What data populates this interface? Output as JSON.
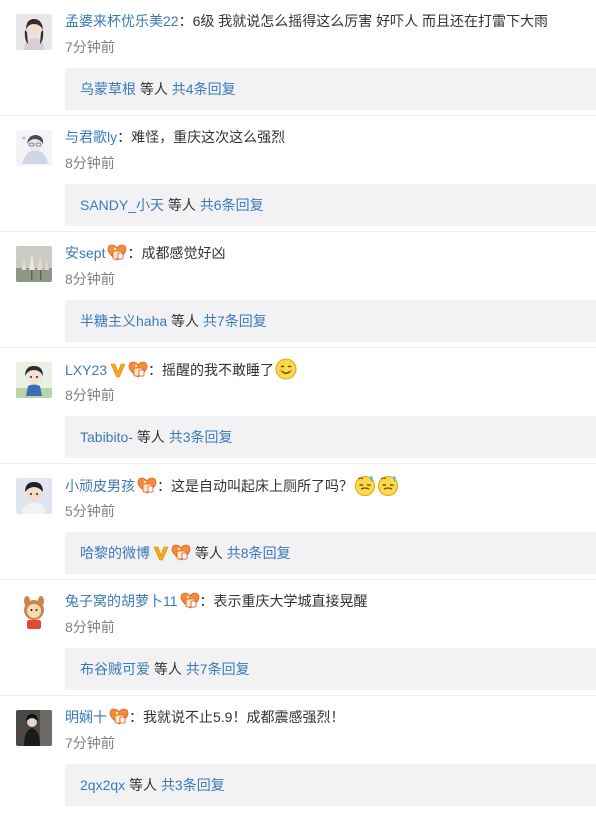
{
  "comments": [
    {
      "username": "孟婆来杯优乐美22",
      "sep": "：",
      "text": "6级 我就说怎么摇得这么厉害 好吓人 而且还在打雷下大雨",
      "time": "7分钟前",
      "reply_user": "乌蒙草根",
      "reply_mid": " 等人 ",
      "reply_count": "共4条回复"
    },
    {
      "username": "与君歌ly",
      "sep": "：",
      "text": "难怪，重庆这次这么强烈",
      "time": "8分钟前",
      "reply_user": "SANDY_小天",
      "reply_mid": " 等人 ",
      "reply_count": "共6条回复"
    },
    {
      "username": "安sept",
      "sep": "：",
      "text": "成都感觉好凶",
      "time": "8分钟前",
      "reply_user": "半糖主义haha",
      "reply_mid": " 等人 ",
      "reply_count": "共7条回复"
    },
    {
      "username": "LXY23",
      "sep": "：",
      "text": "摇醒的我不敢睡了",
      "time": "8分钟前",
      "reply_user": "Tabibito-",
      "reply_mid": " 等人 ",
      "reply_count": "共3条回复"
    },
    {
      "username": "小顽皮男孩",
      "sep": "：",
      "text": "这是自动叫起床上厕所了吗？",
      "time": "5分钟前",
      "reply_user": "哈黎的微博",
      "reply_mid": " 等人 ",
      "reply_count": "共8条回复"
    },
    {
      "username": "兔子窝的胡萝卜11",
      "sep": "：",
      "text": "表示重庆大学城直接晃醒",
      "time": "8分钟前",
      "reply_user": "布谷贼可爱",
      "reply_mid": " 等人 ",
      "reply_count": "共7条回复"
    },
    {
      "username": "明娴十",
      "sep": "：",
      "text": "我就说不止5.9！成都震感强烈！",
      "time": "7分钟前",
      "reply_user": "2qx2qx",
      "reply_mid": " 等人 ",
      "reply_count": "共3条回复"
    }
  ],
  "colors": {
    "link": "#3a7ab8",
    "text": "#333333",
    "time": "#808080",
    "reply_bg": "#f2f2f5",
    "vip_gold": "#f5a623"
  },
  "icons": {
    "fan_badge": "fan-badge-icon",
    "verified": "verified-v-icon",
    "emoji_smile": "smile-emoji",
    "emoji_sleepy": "sleepy-sweat-emoji"
  }
}
